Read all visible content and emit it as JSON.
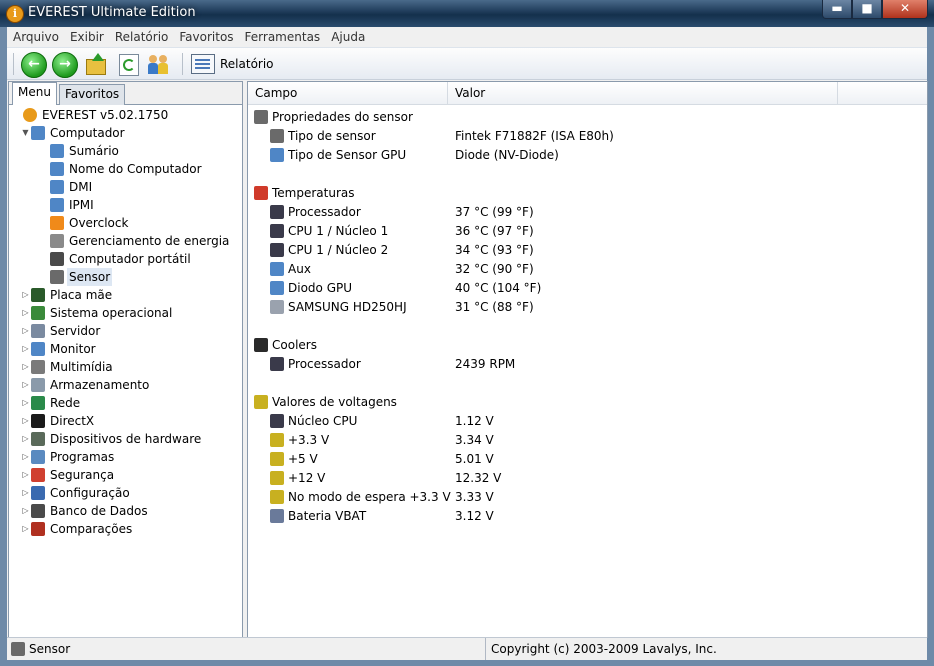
{
  "window": {
    "title": "EVEREST Ultimate Edition",
    "min": "▬",
    "max": "■",
    "close": "✕"
  },
  "menu": [
    "Arquivo",
    "Exibir",
    "Relatório",
    "Favoritos",
    "Ferramentas",
    "Ajuda"
  ],
  "toolbar": {
    "report_label": "Relatório",
    "back": "←",
    "forward": "→"
  },
  "tabs": [
    "Menu",
    "Favoritos"
  ],
  "tree": [
    {
      "label": "EVEREST v5.02.1750",
      "level": 0,
      "icon": "info-icon",
      "color": "#e89a1a",
      "tw": ""
    },
    {
      "label": "Computador",
      "level": 1,
      "icon": "computer-icon",
      "color": "#4f86c6",
      "tw": "▼"
    },
    {
      "label": "Sumário",
      "level": 2,
      "icon": "computer-icon",
      "color": "#4f86c6",
      "tw": ""
    },
    {
      "label": "Nome do Computador",
      "level": 2,
      "icon": "computer-icon",
      "color": "#4f86c6",
      "tw": ""
    },
    {
      "label": "DMI",
      "level": 2,
      "icon": "computer-icon",
      "color": "#4f86c6",
      "tw": ""
    },
    {
      "label": "IPMI",
      "level": 2,
      "icon": "computer-icon",
      "color": "#4f86c6",
      "tw": ""
    },
    {
      "label": "Overclock",
      "level": 2,
      "icon": "flame-icon",
      "color": "#f08a1a",
      "tw": ""
    },
    {
      "label": "Gerenciamento de energia",
      "level": 2,
      "icon": "power-plug-icon",
      "color": "#8a8a8a",
      "tw": ""
    },
    {
      "label": "Computador portátil",
      "level": 2,
      "icon": "laptop-icon",
      "color": "#4a4a4a",
      "tw": ""
    },
    {
      "label": "Sensor",
      "level": 2,
      "icon": "sensor-chip-icon",
      "color": "#6a6a6a",
      "tw": "",
      "selected": true
    },
    {
      "label": "Placa mãe",
      "level": 1,
      "icon": "motherboard-icon",
      "color": "#2a5a2a",
      "tw": "▷"
    },
    {
      "label": "Sistema operacional",
      "level": 1,
      "icon": "windows-logo-icon",
      "color": "#3a8a3a",
      "tw": "▷"
    },
    {
      "label": "Servidor",
      "level": 1,
      "icon": "server-icon",
      "color": "#7a8aa0",
      "tw": "▷"
    },
    {
      "label": "Monitor",
      "level": 1,
      "icon": "monitor-icon",
      "color": "#4f86c6",
      "tw": "▷"
    },
    {
      "label": "Multimídia",
      "level": 1,
      "icon": "speaker-icon",
      "color": "#7a7a7a",
      "tw": "▷"
    },
    {
      "label": "Armazenamento",
      "level": 1,
      "icon": "storage-icon",
      "color": "#8a9aaa",
      "tw": "▷"
    },
    {
      "label": "Rede",
      "level": 1,
      "icon": "globe-icon",
      "color": "#2a8a4a",
      "tw": "▷"
    },
    {
      "label": "DirectX",
      "level": 1,
      "icon": "directx-icon",
      "color": "#1a1a1a",
      "tw": "▷"
    },
    {
      "label": "Dispositivos de hardware",
      "level": 1,
      "icon": "hardware-icon",
      "color": "#5a6a5a",
      "tw": "▷"
    },
    {
      "label": "Programas",
      "level": 1,
      "icon": "programs-icon",
      "color": "#5a8ac0",
      "tw": "▷"
    },
    {
      "label": "Segurança",
      "level": 1,
      "icon": "shield-icon",
      "color": "#d04030",
      "tw": "▷"
    },
    {
      "label": "Configuração",
      "level": 1,
      "icon": "configuration-icon",
      "color": "#3a6ab0",
      "tw": "▷"
    },
    {
      "label": "Banco de Dados",
      "level": 1,
      "icon": "database-icon",
      "color": "#4a4a4a",
      "tw": "▷"
    },
    {
      "label": "Comparações",
      "level": 1,
      "icon": "hourglass-icon",
      "color": "#b03020",
      "tw": "▷"
    }
  ],
  "columns": [
    "Campo",
    "Valor"
  ],
  "groups": [
    {
      "title": "Propriedades do sensor",
      "icon": "sensor-chip-icon",
      "color": "#6a6a6a",
      "items": [
        {
          "field": "Tipo de sensor",
          "value": "Fintek F71882F  (ISA E80h)",
          "icon": "sensor-chip-icon",
          "color": "#6a6a6a"
        },
        {
          "field": "Tipo de Sensor GPU",
          "value": "Diode  (NV-Diode)",
          "icon": "gpu-icon",
          "color": "#4f86c6"
        }
      ]
    },
    {
      "title": "Temperaturas",
      "icon": "thermometer-icon",
      "color": "#d03a2a",
      "items": [
        {
          "field": "Processador",
          "value": "37 °C  (99 °F)",
          "icon": "cpu-icon",
          "color": "#3a3a4a"
        },
        {
          "field": "CPU 1 / Núcleo 1",
          "value": "36 °C  (97 °F)",
          "icon": "cpu-icon",
          "color": "#3a3a4a"
        },
        {
          "field": "CPU 1 / Núcleo 2",
          "value": "34 °C  (93 °F)",
          "icon": "cpu-icon",
          "color": "#3a3a4a"
        },
        {
          "field": "Aux",
          "value": "32 °C  (90 °F)",
          "icon": "computer-icon",
          "color": "#4f86c6"
        },
        {
          "field": "Diodo GPU",
          "value": "40 °C  (104 °F)",
          "icon": "gpu-icon",
          "color": "#4f86c6"
        },
        {
          "field": "SAMSUNG HD250HJ",
          "value": "31 °C  (88 °F)",
          "icon": "hard-drive-icon",
          "color": "#9aa2ae"
        }
      ]
    },
    {
      "title": "Coolers",
      "icon": "fan-icon",
      "color": "#2a2a2a",
      "items": [
        {
          "field": "Processador",
          "value": "2439 RPM",
          "icon": "cpu-icon",
          "color": "#3a3a4a"
        }
      ]
    },
    {
      "title": "Valores de voltagens",
      "icon": "voltage-warning-icon",
      "color": "#c8b020",
      "items": [
        {
          "field": "Núcleo CPU",
          "value": "1.12 V",
          "icon": "cpu-icon",
          "color": "#3a3a4a"
        },
        {
          "field": "+3.3 V",
          "value": "3.34 V",
          "icon": "voltage-warning-icon",
          "color": "#c8b020"
        },
        {
          "field": "+5 V",
          "value": "5.01 V",
          "icon": "voltage-warning-icon",
          "color": "#c8b020"
        },
        {
          "field": "+12 V",
          "value": "12.32 V",
          "icon": "voltage-warning-icon",
          "color": "#c8b020"
        },
        {
          "field": "No modo de espera +3.3 V",
          "value": "3.33 V",
          "icon": "voltage-warning-icon",
          "color": "#c8b020"
        },
        {
          "field": "Bateria VBAT",
          "value": "3.12 V",
          "icon": "battery-icon",
          "color": "#6a7a9a"
        }
      ]
    }
  ],
  "status": {
    "left": "Sensor",
    "right": "Copyright (c) 2003-2009 Lavalys, Inc."
  }
}
